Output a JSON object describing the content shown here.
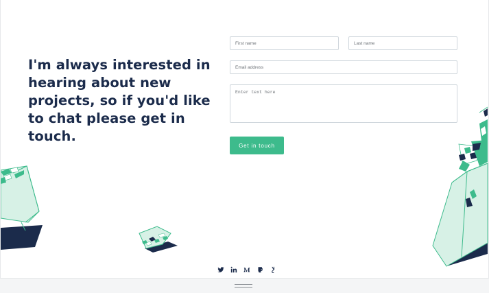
{
  "contact": {
    "heading": "I'm always interested in hearing about new projects, so if you'd like to chat please get in touch.",
    "form": {
      "first_name_placeholder": "First name",
      "last_name_placeholder": "Last name",
      "email_placeholder": "Email address",
      "message_placeholder": "Enter text here",
      "submit_label": "Get in touch"
    }
  },
  "socials": [
    "twitter-icon",
    "linkedin-icon",
    "medium-icon",
    "codepen-icon",
    "dribbble-icon"
  ],
  "colors": {
    "navy": "#1b2b4b",
    "accent": "#3dbb8c",
    "border": "#cfd6dc",
    "footer_bg": "#f4f5f6"
  }
}
